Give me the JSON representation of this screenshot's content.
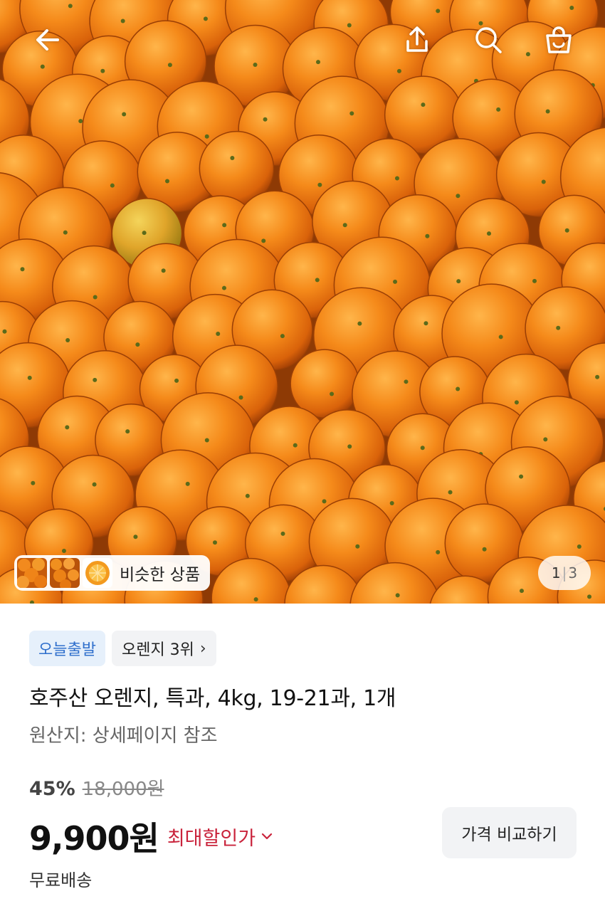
{
  "header": {
    "back_icon": "arrow-left-icon",
    "share_icon": "share-icon",
    "search_icon": "search-icon",
    "cart_icon": "shopping-bag-icon"
  },
  "gallery": {
    "similar_label": "비슷한 상품",
    "pager_current": "1",
    "pager_sep": "|",
    "pager_total": "3"
  },
  "badges": {
    "today_label": "오늘출발",
    "rank_label": "오렌지 3위"
  },
  "product": {
    "title": "호주산 오렌지, 특과, 4kg, 19-21과, 1개",
    "origin": "원산지: 상세페이지 참조",
    "discount": "45%",
    "original_price": "18,000원",
    "price": "9,900원",
    "max_discount_label": "최대할인가",
    "compare_button": "가격 비교하기",
    "shipping": "무료배송"
  },
  "colors": {
    "accent_blue": "#2f6fcc",
    "discount_red": "#c9233b",
    "orange": "#f08a1c"
  }
}
